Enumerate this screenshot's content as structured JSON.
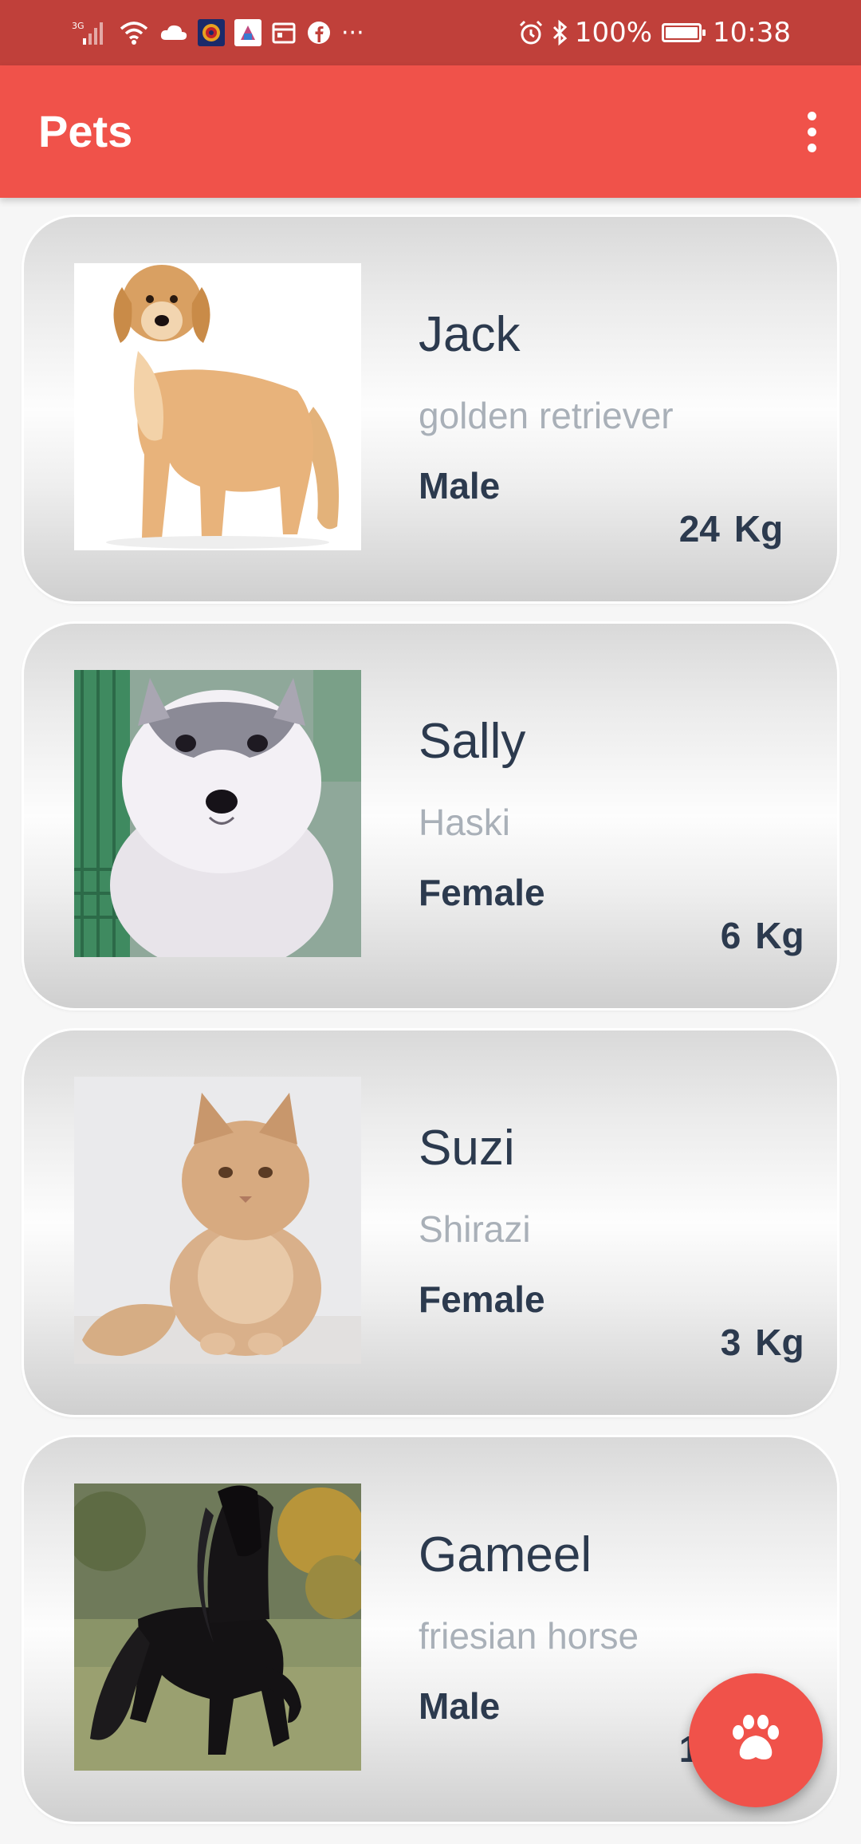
{
  "status_bar": {
    "network": "3G",
    "battery": "100%",
    "battery_level": 1.0,
    "time": "10:38",
    "more": "···"
  },
  "app_bar": {
    "title": "Pets",
    "menu_icon": "more-vert-icon"
  },
  "pets": [
    {
      "name": "Jack",
      "breed": "golden retriever",
      "gender": "Male",
      "weight": "24",
      "unit": "Kg",
      "photo": "golden-retriever-photo"
    },
    {
      "name": "Sally",
      "breed": "Haski",
      "gender": "Female",
      "weight": "6",
      "unit": "Kg",
      "photo": "husky-puppy-photo"
    },
    {
      "name": "Suzi",
      "breed": "Shirazi",
      "gender": "Female",
      "weight": "3",
      "unit": "Kg",
      "photo": "persian-kitten-photo"
    },
    {
      "name": "Gameel",
      "breed": "friesian horse",
      "gender": "Male",
      "weight": "120",
      "unit": "Kg",
      "photo": "friesian-horse-photo"
    }
  ],
  "fab": {
    "icon": "paw-icon"
  },
  "colors": {
    "status_bar": "#c0403a",
    "app_bar": "#f0524a",
    "name_text": "#2c3a4e",
    "breed_text": "#a9b0b8",
    "fab": "#f0524a"
  }
}
